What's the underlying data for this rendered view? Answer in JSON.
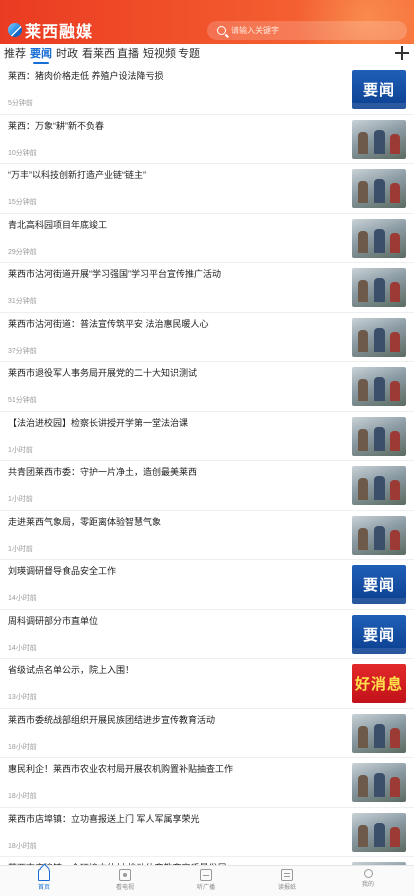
{
  "header": {
    "brand": "莱西融媒",
    "search_placeholder": "请输入关键字"
  },
  "tabs": [
    {
      "label": "推荐",
      "active": false
    },
    {
      "label": "要闻",
      "active": true
    },
    {
      "label": "时政",
      "active": false
    },
    {
      "label": "看莱西",
      "active": false
    },
    {
      "label": "直播",
      "active": false
    },
    {
      "label": "短视频",
      "active": false
    },
    {
      "label": "专题",
      "active": false
    }
  ],
  "news": [
    {
      "title": "莱西：猪肉价格走低  养殖户设法降亏损",
      "time": "5分钟前",
      "thumb": "badge-blue",
      "badge_text": "要闻"
    },
    {
      "title": "莱西：万象“耕”新不负春",
      "time": "10分钟前",
      "thumb": "photo"
    },
    {
      "title": "“万丰”以科技创新打造产业链“链主”",
      "time": "15分钟前",
      "thumb": "photo"
    },
    {
      "title": "青北高科园项目年底竣工",
      "time": "29分钟前",
      "thumb": "photo"
    },
    {
      "title": "莱西市沽河街道开展“学习强国”学习平台宣传推广活动",
      "time": "31分钟前",
      "thumb": "photo"
    },
    {
      "title": "莱西市沽河街道：普法宣传筑平安  法治惠民暖人心",
      "time": "37分钟前",
      "thumb": "photo"
    },
    {
      "title": "莱西市退役军人事务局开展党的二十大知识测试",
      "time": "51分钟前",
      "thumb": "photo"
    },
    {
      "title": "【法治进校园】检察长讲授开学第一堂法治课",
      "time": "1小时前",
      "thumb": "photo"
    },
    {
      "title": "共青团莱西市委：守护一片净土，造创最美莱西",
      "time": "1小时前",
      "thumb": "photo"
    },
    {
      "title": "走进莱西气象局，零距离体验智慧气象",
      "time": "1小时前",
      "thumb": "photo"
    },
    {
      "title": "刘瑛调研督导食品安全工作",
      "time": "14小时前",
      "thumb": "badge-blue",
      "badge_text": "要闻"
    },
    {
      "title": "周科调研部分市直单位",
      "time": "14小时前",
      "thumb": "badge-blue",
      "badge_text": "要闻"
    },
    {
      "title": "省级试点名单公示，院上入围！",
      "time": "13小时前",
      "thumb": "badge-red",
      "badge_text": "好消息"
    },
    {
      "title": "莱西市委统战部组织开展民族团结进步宣传教育活动",
      "time": "18小时前",
      "thumb": "photo"
    },
    {
      "title": "惠民利企！莱西市农业农村局开展农机购置补贴抽查工作",
      "time": "18小时前",
      "thumb": "photo"
    },
    {
      "title": "莱西市店埠镇：立功喜报送上门  军人军属享荣光",
      "time": "18小时前",
      "thumb": "photo"
    },
    {
      "title": "莱西市店埠镇：今环境文体村  推动体育教育高质量发展",
      "time": "",
      "thumb": "photo"
    }
  ],
  "bottom_nav": [
    {
      "label": "首页",
      "icon": "home-icon",
      "active": true
    },
    {
      "label": "看电视",
      "icon": "tv-icon",
      "active": false
    },
    {
      "label": "听广播",
      "icon": "radio-icon",
      "active": false
    },
    {
      "label": "读报纸",
      "icon": "news-icon",
      "active": false
    },
    {
      "label": "我的",
      "icon": "user-icon",
      "active": false
    }
  ],
  "colors": {
    "header_red": "#ea3b22",
    "accent_blue": "#1a6fd6",
    "badge_blue": "#0b3f8f",
    "badge_red": "#d21a20"
  }
}
